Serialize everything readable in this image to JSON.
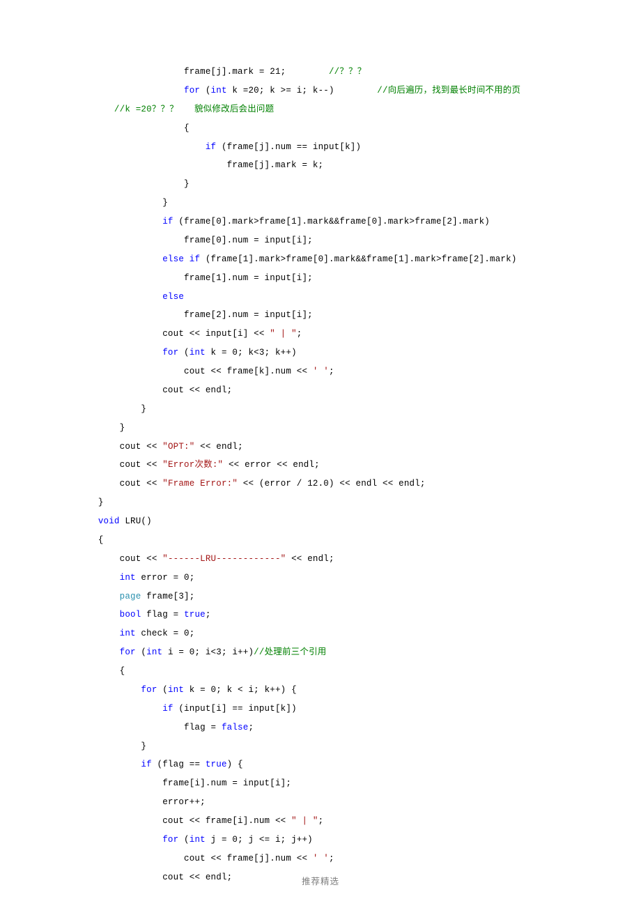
{
  "footer": "推荐精选",
  "lines": [
    {
      "indent": 5,
      "segs": [
        {
          "t": "frame[j].mark = 21;        "
        },
        {
          "t": "//？？？",
          "c": "cm"
        }
      ]
    },
    {
      "indent": 5,
      "segs": [
        {
          "t": "for",
          "c": "kw"
        },
        {
          "t": " ("
        },
        {
          "t": "int",
          "c": "kw"
        },
        {
          "t": " k =20; k >= i; k--)        "
        },
        {
          "t": "//向后遍历，找到最长时间不用的页",
          "c": "cm"
        }
      ]
    },
    {
      "indent": 0,
      "segs": [
        {
          "t": "       "
        },
        {
          "t": "//k =20？？？   貌似修改后会出问题",
          "c": "cm"
        }
      ]
    },
    {
      "indent": 5,
      "segs": [
        {
          "t": "{"
        }
      ]
    },
    {
      "indent": 6,
      "segs": [
        {
          "t": "if",
          "c": "kw"
        },
        {
          "t": " (frame[j].num == input[k])"
        }
      ]
    },
    {
      "indent": 7,
      "segs": [
        {
          "t": "frame[j].mark = k;"
        }
      ]
    },
    {
      "indent": 5,
      "segs": [
        {
          "t": "}"
        }
      ]
    },
    {
      "indent": 4,
      "segs": [
        {
          "t": "}"
        }
      ]
    },
    {
      "indent": 4,
      "segs": [
        {
          "t": "if",
          "c": "kw"
        },
        {
          "t": " (frame[0].mark>frame[1].mark&&frame[0].mark>frame[2].mark)"
        }
      ]
    },
    {
      "indent": 5,
      "segs": [
        {
          "t": "frame[0].num = input[i];"
        }
      ]
    },
    {
      "indent": 4,
      "segs": [
        {
          "t": "else",
          "c": "kw"
        },
        {
          "t": " "
        },
        {
          "t": "if",
          "c": "kw"
        },
        {
          "t": " (frame[1].mark>frame[0].mark&&frame[1].mark>frame[2].mark)"
        }
      ]
    },
    {
      "indent": 5,
      "segs": [
        {
          "t": "frame[1].num = input[i];"
        }
      ]
    },
    {
      "indent": 4,
      "segs": [
        {
          "t": "else",
          "c": "kw"
        }
      ]
    },
    {
      "indent": 5,
      "segs": [
        {
          "t": "frame[2].num = input[i];"
        }
      ]
    },
    {
      "indent": 4,
      "segs": [
        {
          "t": "cout << input[i] << "
        },
        {
          "t": "\" | \"",
          "c": "str"
        },
        {
          "t": ";"
        }
      ]
    },
    {
      "indent": 4,
      "segs": [
        {
          "t": "for",
          "c": "kw"
        },
        {
          "t": " ("
        },
        {
          "t": "int",
          "c": "kw"
        },
        {
          "t": " k = 0; k<3; k++)"
        }
      ]
    },
    {
      "indent": 5,
      "segs": [
        {
          "t": "cout << frame[k].num << "
        },
        {
          "t": "' '",
          "c": "str"
        },
        {
          "t": ";"
        }
      ]
    },
    {
      "indent": 4,
      "segs": [
        {
          "t": "cout << endl;"
        }
      ]
    },
    {
      "indent": 3,
      "segs": [
        {
          "t": "}"
        }
      ]
    },
    {
      "indent": 2,
      "segs": [
        {
          "t": "}"
        }
      ]
    },
    {
      "indent": 2,
      "segs": [
        {
          "t": "cout << "
        },
        {
          "t": "\"OPT:\"",
          "c": "str"
        },
        {
          "t": " << endl;"
        }
      ]
    },
    {
      "indent": 2,
      "segs": [
        {
          "t": "cout << "
        },
        {
          "t": "\"Error次数:\"",
          "c": "str"
        },
        {
          "t": " << error << endl;"
        }
      ]
    },
    {
      "indent": 2,
      "segs": [
        {
          "t": "cout << "
        },
        {
          "t": "\"Frame Error:\"",
          "c": "str"
        },
        {
          "t": " << (error / 12.0) << endl << endl;"
        }
      ]
    },
    {
      "indent": 1,
      "segs": [
        {
          "t": "}"
        }
      ]
    },
    {
      "indent": 1,
      "segs": [
        {
          "t": "void",
          "c": "kw"
        },
        {
          "t": " LRU()"
        }
      ]
    },
    {
      "indent": 1,
      "segs": [
        {
          "t": "{"
        }
      ]
    },
    {
      "indent": 2,
      "segs": [
        {
          "t": "cout << "
        },
        {
          "t": "\"------LRU------------\"",
          "c": "str"
        },
        {
          "t": " << endl;"
        }
      ]
    },
    {
      "indent": 2,
      "segs": [
        {
          "t": "int",
          "c": "kw"
        },
        {
          "t": " error = 0;"
        }
      ]
    },
    {
      "indent": 2,
      "segs": [
        {
          "t": "page",
          "c": "tp"
        },
        {
          "t": " frame[3];"
        }
      ]
    },
    {
      "indent": 2,
      "segs": [
        {
          "t": "bool",
          "c": "kw"
        },
        {
          "t": " flag = "
        },
        {
          "t": "true",
          "c": "kw"
        },
        {
          "t": ";"
        }
      ]
    },
    {
      "indent": 2,
      "segs": [
        {
          "t": "int",
          "c": "kw"
        },
        {
          "t": " check = 0;"
        }
      ]
    },
    {
      "indent": 2,
      "segs": [
        {
          "t": "for",
          "c": "kw"
        },
        {
          "t": " ("
        },
        {
          "t": "int",
          "c": "kw"
        },
        {
          "t": " i = 0; i<3; i++)"
        },
        {
          "t": "//处理前三个引用",
          "c": "cm"
        }
      ]
    },
    {
      "indent": 2,
      "segs": [
        {
          "t": "{"
        }
      ]
    },
    {
      "indent": 3,
      "segs": [
        {
          "t": "for",
          "c": "kw"
        },
        {
          "t": " ("
        },
        {
          "t": "int",
          "c": "kw"
        },
        {
          "t": " k = 0; k < i; k++) {"
        }
      ]
    },
    {
      "indent": 4,
      "segs": [
        {
          "t": "if",
          "c": "kw"
        },
        {
          "t": " (input[i] == input[k])"
        }
      ]
    },
    {
      "indent": 5,
      "segs": [
        {
          "t": "flag = "
        },
        {
          "t": "false",
          "c": "kw"
        },
        {
          "t": ";"
        }
      ]
    },
    {
      "indent": 3,
      "segs": [
        {
          "t": "}"
        }
      ]
    },
    {
      "indent": 3,
      "segs": [
        {
          "t": "if",
          "c": "kw"
        },
        {
          "t": " (flag == "
        },
        {
          "t": "true",
          "c": "kw"
        },
        {
          "t": ") {"
        }
      ]
    },
    {
      "indent": 4,
      "segs": [
        {
          "t": "frame[i].num = input[i];"
        }
      ]
    },
    {
      "indent": 4,
      "segs": [
        {
          "t": "error++;"
        }
      ]
    },
    {
      "indent": 4,
      "segs": [
        {
          "t": "cout << frame[i].num << "
        },
        {
          "t": "\" | \"",
          "c": "str"
        },
        {
          "t": ";"
        }
      ]
    },
    {
      "indent": 4,
      "segs": [
        {
          "t": "for",
          "c": "kw"
        },
        {
          "t": " ("
        },
        {
          "t": "int",
          "c": "kw"
        },
        {
          "t": " j = 0; j <= i; j++)"
        }
      ]
    },
    {
      "indent": 5,
      "segs": [
        {
          "t": "cout << frame[j].num << "
        },
        {
          "t": "' '",
          "c": "str"
        },
        {
          "t": ";"
        }
      ]
    },
    {
      "indent": 4,
      "segs": [
        {
          "t": "cout << endl;"
        }
      ]
    }
  ]
}
